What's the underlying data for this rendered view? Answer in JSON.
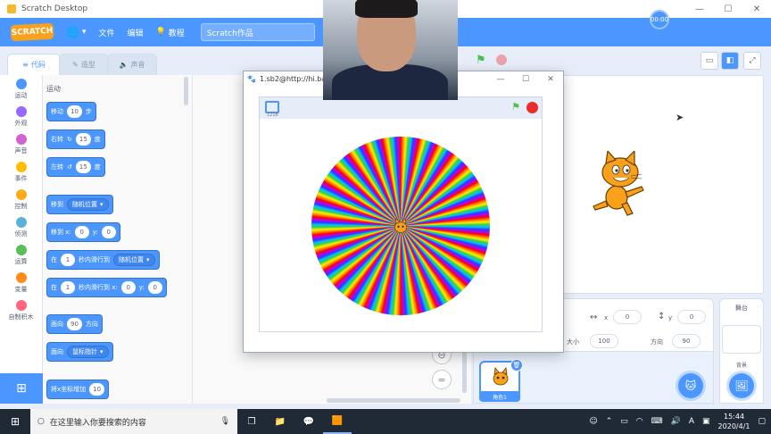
{
  "window": {
    "title": "Scratch Desktop",
    "timer_badge": "00:00"
  },
  "menubar": {
    "logo": "SCRATCH",
    "globe_icon": "globe-icon",
    "file": "文件",
    "edit": "编辑",
    "tutorials": "教程",
    "project_title": "Scratch作品"
  },
  "tabs": [
    {
      "label": "代码",
      "active": true
    },
    {
      "label": "造型",
      "active": false
    },
    {
      "label": "声音",
      "active": false
    }
  ],
  "categories": [
    {
      "label": "运动",
      "color": "#4c97ff"
    },
    {
      "label": "外观",
      "color": "#9966ff"
    },
    {
      "label": "声音",
      "color": "#cf63cf"
    },
    {
      "label": "事件",
      "color": "#ffbf00"
    },
    {
      "label": "控制",
      "color": "#ffab19"
    },
    {
      "label": "侦测",
      "color": "#5cb1d6"
    },
    {
      "label": "运算",
      "color": "#59c059"
    },
    {
      "label": "变量",
      "color": "#ff8c1a"
    },
    {
      "label": "自制积木",
      "color": "#ff6680"
    }
  ],
  "palette": {
    "heading": "运动",
    "move": {
      "a": "移动",
      "n": "10",
      "b": "步"
    },
    "turn_right": {
      "a": "右转",
      "n": "15",
      "b": "度"
    },
    "turn_left": {
      "a": "左转",
      "n": "15",
      "b": "度"
    },
    "goto": {
      "a": "移到",
      "dd": "随机位置"
    },
    "goto_xy": {
      "a": "移到 x:",
      "x": "0",
      "y_label": "y:",
      "y": "0"
    },
    "glide": {
      "a": "在",
      "n": "1",
      "b": "秒内滑行到",
      "dd": "随机位置"
    },
    "glide_xy": {
      "a": "在",
      "n": "1",
      "b": "秒内滑行到 x:",
      "x": "0",
      "y_label": "y:",
      "y": "0"
    },
    "point_dir": {
      "a": "面向",
      "n": "90",
      "b": "方向"
    },
    "point_towards": {
      "a": "面向",
      "dd": "鼠标指针"
    },
    "change_x": {
      "a": "将x坐标增加",
      "n": "10"
    }
  },
  "player": {
    "title": "1.sb2@http://hi.ba",
    "counter": "1218"
  },
  "sprite_info": {
    "x_label": "x",
    "x": "0",
    "y_label": "y",
    "y": "0",
    "size_label": "大小",
    "size": "100",
    "direction_label": "方向",
    "direction": "90"
  },
  "sprite_list": {
    "sprite_name": "角色1"
  },
  "backdrop_panel": {
    "label": "舞台",
    "sub_label": "背景"
  },
  "taskbar": {
    "search_placeholder": "在这里输入你要搜索的内容",
    "ime": "A",
    "time": "15:44",
    "date": "2020/4/1"
  }
}
